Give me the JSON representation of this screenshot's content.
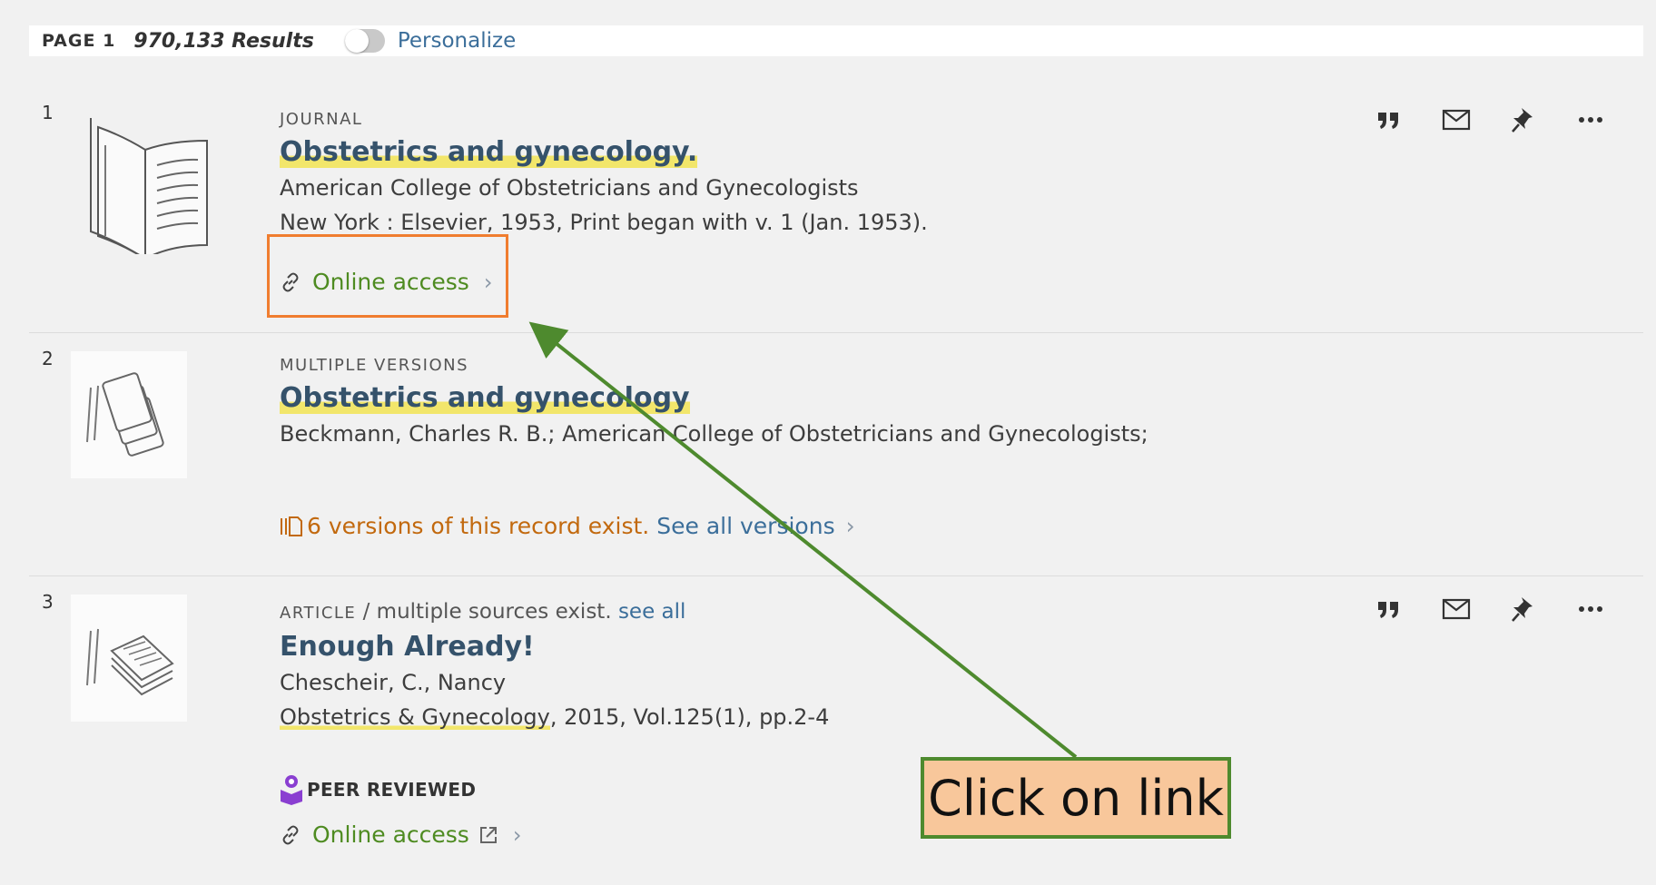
{
  "header": {
    "page_label": "PAGE 1",
    "results_count": "970,133 Results",
    "personalize_label": "Personalize"
  },
  "results": [
    {
      "index": "1",
      "type": "JOURNAL",
      "title": "Obstetrics and gynecology.",
      "author": "American College of Obstetricians and Gynecologists",
      "publication": "New York : Elsevier, 1953, Print began with v. 1 (Jan. 1953).",
      "access_label": "Online access",
      "thumbnail_icon": "book-icon"
    },
    {
      "index": "2",
      "type": "MULTIPLE VERSIONS",
      "title": "Obstetrics and gynecology",
      "author": "Beckmann, Charles R. B.; American College of Obstetricians and Gynecologists;",
      "versions_text": "6 versions of this record exist.",
      "see_versions_label": "See all versions",
      "thumbnail_icon": "multiple-versions-icon"
    },
    {
      "index": "3",
      "type": "ARTICLE",
      "type_suffix": " / multiple sources exist.",
      "see_all_label": "see all",
      "title": "Enough Already!",
      "author": "Chescheir, C., Nancy",
      "journal": "Obstetrics & Gynecology",
      "journal_details": ", 2015, Vol.125(1), pp.2-4",
      "peer_reviewed_label": "PEER REVIEWED",
      "access_label": "Online access",
      "thumbnail_icon": "article-icon"
    }
  ],
  "annotation": {
    "callout_text": "Click on link",
    "highlight_color": "#f07d2f",
    "arrow_color": "#4e8a2e"
  },
  "colors": {
    "link_blue": "#3b6e9a",
    "access_green": "#4e8b21",
    "versions_orange": "#c2690e",
    "title_color": "#35526b",
    "highlight_yellow": "#f2e66b",
    "peer_purple": "#8a3fd1"
  }
}
